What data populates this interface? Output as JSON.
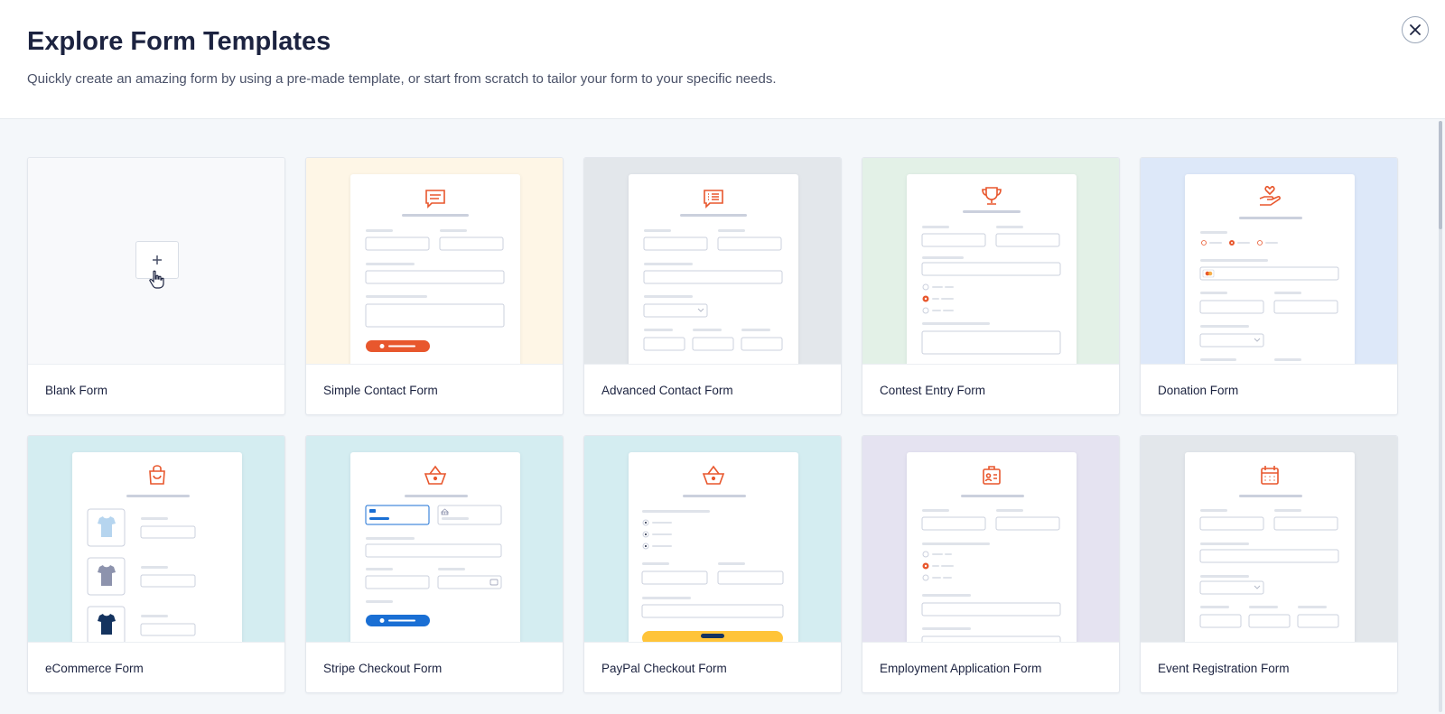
{
  "header": {
    "title": "Explore Form Templates",
    "subtitle": "Quickly create an amazing form by using a pre-made template, or start from scratch to tailor your form to your specific needs."
  },
  "templates": [
    {
      "label": "Blank Form",
      "bg": "#f8f9fb",
      "icon": "plus-icon"
    },
    {
      "label": "Simple Contact Form",
      "bg": "#fef6e6",
      "icon": "chat-icon"
    },
    {
      "label": "Advanced Contact Form",
      "bg": "#e3e7eb",
      "icon": "chat-list-icon"
    },
    {
      "label": "Contest Entry Form",
      "bg": "#e3f1e7",
      "icon": "trophy-icon"
    },
    {
      "label": "Donation Form",
      "bg": "#dde8f9",
      "icon": "hand-heart-icon"
    },
    {
      "label": "eCommerce Form",
      "bg": "#d4edf1",
      "icon": "shopping-bag-icon"
    },
    {
      "label": "Stripe Checkout Form",
      "bg": "#d4edf1",
      "icon": "basket-icon"
    },
    {
      "label": "PayPal Checkout Form",
      "bg": "#d4edf1",
      "icon": "basket-icon"
    },
    {
      "label": "Employment Application Form",
      "bg": "#e5e3f1",
      "icon": "id-badge-icon"
    },
    {
      "label": "Event Registration Form",
      "bg": "#e3e7eb",
      "icon": "calendar-icon"
    }
  ],
  "colors": {
    "accent": "#e8572d",
    "stripe_blue": "#1a6fd4",
    "paypal_yellow": "#ffc439",
    "line": "#cbd0dd"
  }
}
